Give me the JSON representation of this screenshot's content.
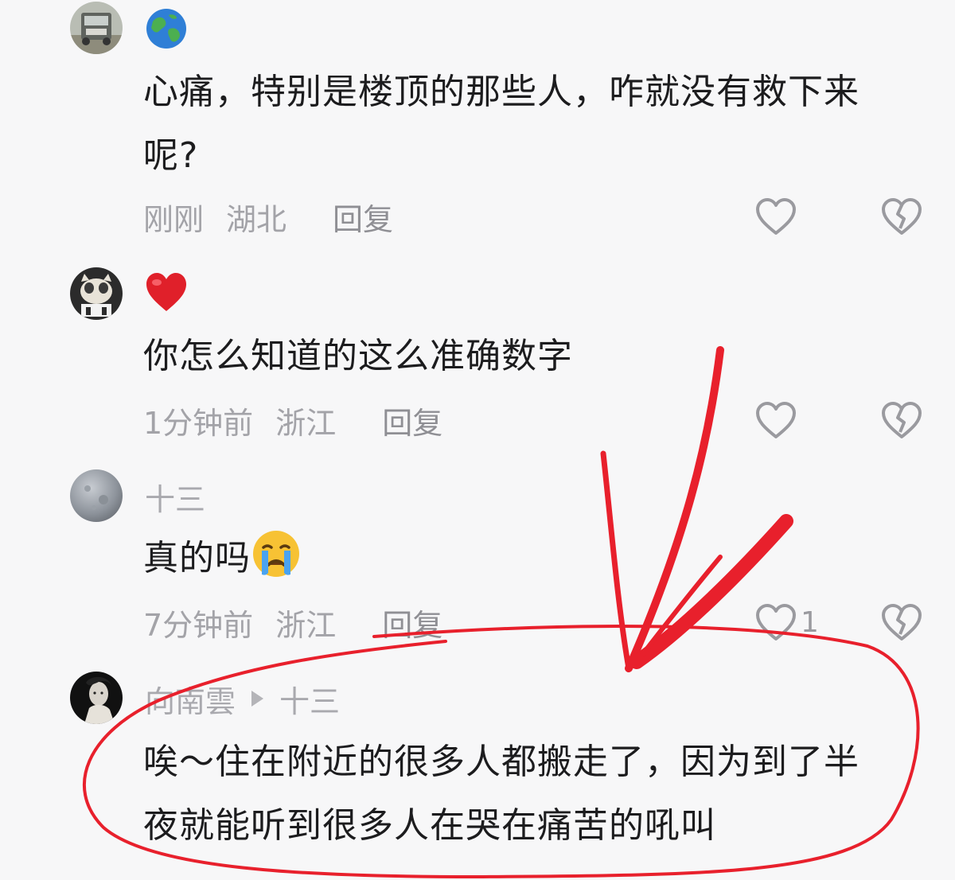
{
  "comments": [
    {
      "avatar": "truck-avatar",
      "username_emoji": "globe-emoji",
      "text": "心痛，特别是楼顶的那些人，咋就没有救下来呢？",
      "line1": "心痛，特别是楼顶的那些人，咋就没有救下来",
      "line2": "呢?",
      "time": "刚刚",
      "location": "湖北",
      "reply_label": "回复",
      "like_count": ""
    },
    {
      "avatar": "cat-avatar",
      "username_emoji": "red-heart-emoji",
      "text": "你怎么知道的这么准确数字",
      "time": "1分钟前",
      "location": "浙江",
      "reply_label": "回复",
      "like_count": ""
    },
    {
      "avatar": "gray-circle-avatar",
      "username": "十三",
      "text": "真的吗",
      "text_emoji": "crying-face-emoji",
      "time": "7分钟前",
      "location": "浙江",
      "reply_label": "回复",
      "like_count": "1"
    },
    {
      "avatar": "dark-portrait-avatar",
      "username": "向南雲",
      "reply_to": "十三",
      "line1": "唉～住在附近的很多人都搬走了，因为到了半",
      "line2": "夜就能听到很多人在哭在痛苦的吼叫"
    }
  ],
  "icons": {
    "like": "heart-outline-icon",
    "dislike": "broken-heart-icon"
  },
  "colors": {
    "background": "#f7f7f8",
    "text": "#1c1c1e",
    "meta": "#a3a3a8",
    "annotation": "#e8202c"
  }
}
